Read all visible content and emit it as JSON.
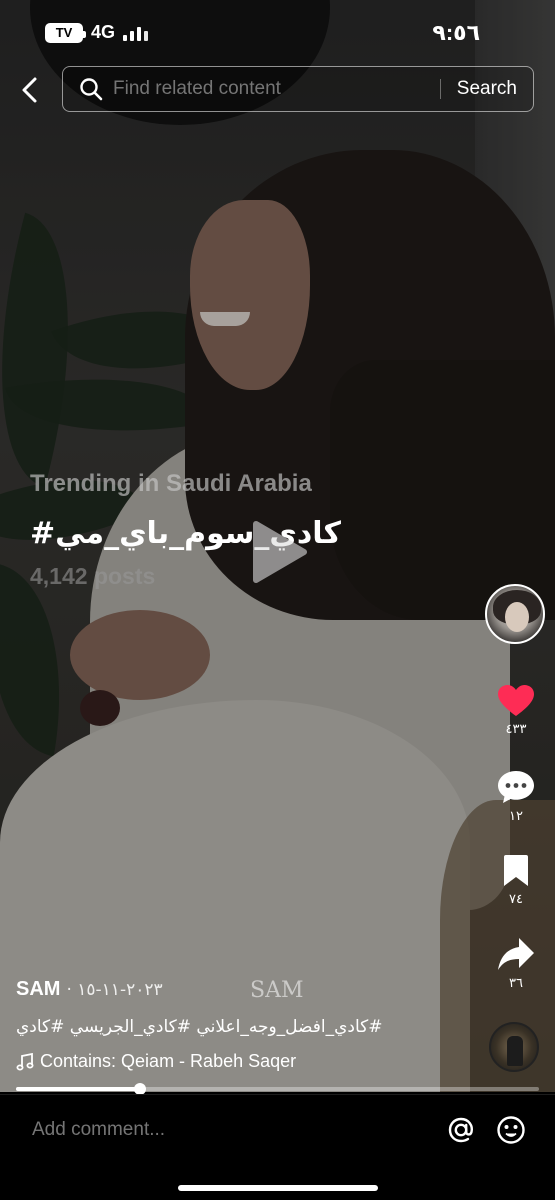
{
  "status_bar": {
    "battery_label": "TV",
    "network": "4G",
    "time": "٩:٥٦"
  },
  "search": {
    "placeholder": "Find related content",
    "button_label": "Search"
  },
  "trending": {
    "label": "Trending in Saudi Arabia",
    "hashtag": "#كادي_سوم_باي_مي",
    "posts": "4,142 posts"
  },
  "watermark": "SAM",
  "actions": {
    "likes": "٤٣٣",
    "comments": "١٢",
    "saves": "٧٤",
    "shares": "٣٦",
    "like_color": "#fe2c55"
  },
  "post": {
    "author": "SAM",
    "date": "· ٢٠٢٣-١١-١٥",
    "caption": "#كادي_افضل_وجه_اعلاني #كادي_الجريسي #كادي",
    "music": "Contains: Qeiam - Rabeh Saqer"
  },
  "playback": {
    "progress_fraction": 0.237
  },
  "comment": {
    "placeholder": "Add comment..."
  },
  "icons": {
    "back": "chevron-left-icon",
    "search": "search-icon",
    "play": "play-icon",
    "like": "heart-icon",
    "comment": "comment-icon",
    "save": "bookmark-icon",
    "share": "share-icon",
    "music": "music-note-icon",
    "mention": "at-icon",
    "emoji": "emoji-icon"
  }
}
